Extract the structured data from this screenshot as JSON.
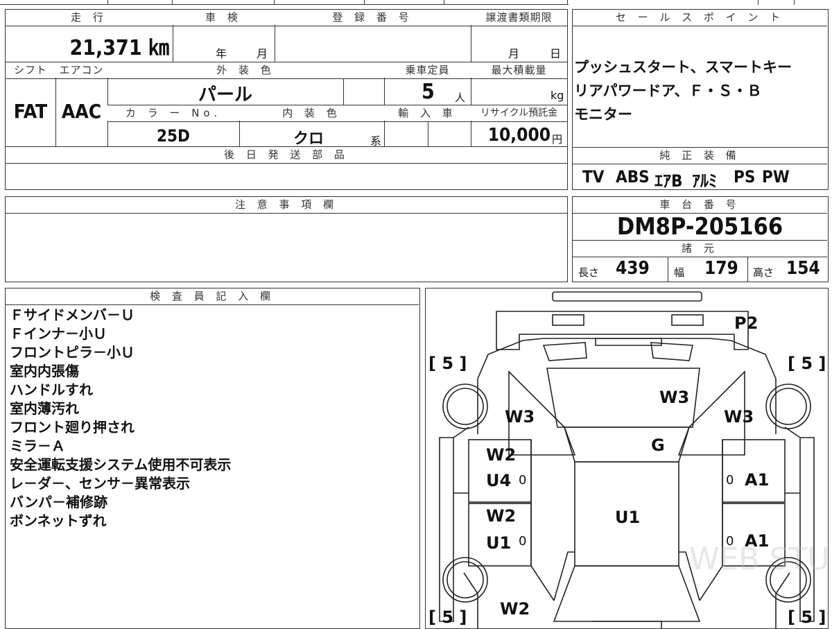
{
  "top_table": {
    "mileage_label": "走 行",
    "mileage_value": "21,371 ㎞",
    "shaken_label": "車 検",
    "shaken_year_unit": "年",
    "shaken_month_unit": "月",
    "reg_label": "登 録 番 号",
    "transfer_label": "譲渡書類期限",
    "transfer_month_unit": "月",
    "transfer_day_unit": "日",
    "shift_label": "シフト",
    "shift_value": "FAT",
    "ac_label": "エアコン",
    "ac_value": "AAC",
    "exterior_label": "外 装 色",
    "exterior_value": "パール",
    "capacity_label": "乗車定員",
    "capacity_value": "5",
    "capacity_unit": "人",
    "load_label": "最大積載量",
    "load_unit": "kg",
    "color_no_label": "カ ラ ー No.",
    "color_no_value": "25D",
    "interior_label": "内 装 色",
    "interior_value": "クロ",
    "interior_suffix": "系",
    "import_label": "輸 入 車",
    "recycle_label": "リサイクル預託金",
    "recycle_value": "10,000",
    "recycle_unit": "円",
    "later_parts_label": "後 日 発 送 部 品"
  },
  "sales_point": {
    "label": "セ ー ル ス ポ イ ン ト",
    "lines": [
      "プッシュスタート、スマートキー",
      "リアパワードア、Ｆ・Ｓ・Ｂ",
      "モニター"
    ]
  },
  "equipment": {
    "label": "純 正 装 備",
    "items": [
      "TV",
      "ABS",
      "ｴｱB",
      "ｱﾙﾐ",
      "PS",
      "PW"
    ]
  },
  "caution": {
    "label": "注 意 事 項 欄"
  },
  "chassis": {
    "label": "車 台 番 号",
    "value": "DM8P-205166",
    "spec_label": "諸 元",
    "length_label": "長さ",
    "length_value": "439",
    "width_label": "幅",
    "width_value": "179",
    "height_label": "高さ",
    "height_value": "154"
  },
  "inspector": {
    "label": "検 査 員 記 入 欄",
    "notes": [
      "Ｆサイドメンバ－Ｕ",
      "Ｆインナ－小Ｕ",
      "フロントピラ－小Ｕ",
      "室内内張傷",
      "ハンドルすれ",
      "室内薄汚れ",
      "フロント廻り押され",
      "ミラ－Ａ",
      "安全運転支援システム使用不可表示",
      "レ－ダ－、センサ－異常表示",
      "バンパ－補修跡",
      "ボンネットずれ"
    ]
  },
  "diagram": {
    "marks": {
      "rear": "P2",
      "tl": "[ 5 ]",
      "tr": "[ 5 ]",
      "bl": "[ 5 ]",
      "br": "[ 5 ]",
      "rear_glass": "W3",
      "left_rear_glass": "W3",
      "right_rear_glass": "W3",
      "roof_g": "G",
      "left_w2a": "W2",
      "left_u4": "U4",
      "left_0a": "0",
      "left_w2b": "W2",
      "left_u1": "U1",
      "left_0b": "0",
      "right_0a": "0",
      "right_a1a": "A1",
      "right_0b": "0",
      "right_a1b": "A1",
      "center": "U1",
      "front": "W2"
    },
    "watermark": "WEB STUDIO PRO"
  }
}
